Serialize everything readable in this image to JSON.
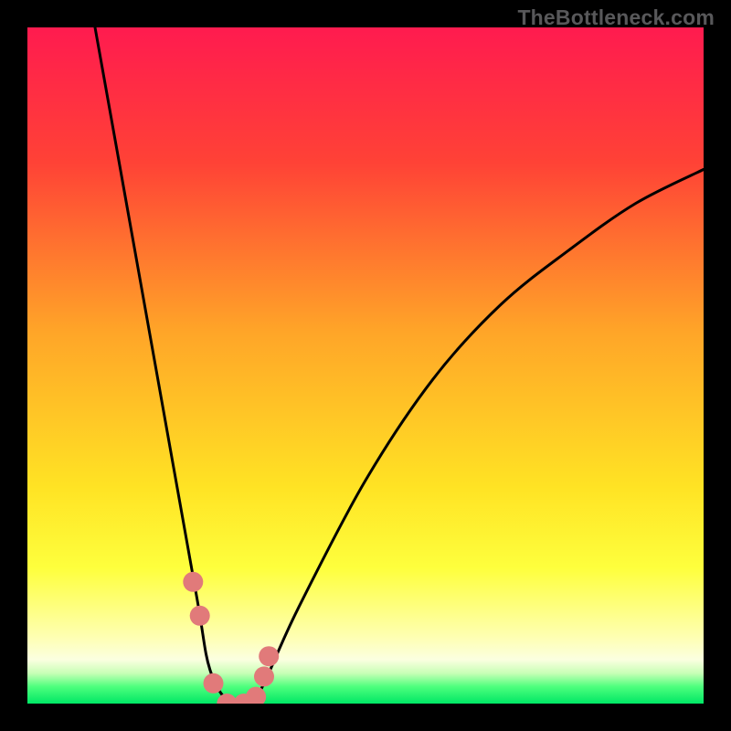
{
  "watermark": "TheBottleneck.com",
  "chart_data": {
    "type": "line",
    "title": "",
    "xlabel": "",
    "ylabel": "",
    "xlim": [
      0,
      100
    ],
    "ylim": [
      0,
      100
    ],
    "series": [
      {
        "name": "bottleneck-curve",
        "x": [
          10,
          15,
          20,
          25,
          27,
          30,
          33,
          35,
          40,
          50,
          60,
          70,
          80,
          90,
          100
        ],
        "values": [
          100,
          72,
          44,
          16,
          5,
          0,
          0,
          3,
          14,
          33,
          48,
          59,
          67,
          74,
          79
        ]
      }
    ],
    "markers": {
      "name": "highlight-points",
      "x": [
        24.5,
        25.5,
        27.5,
        29.5,
        32,
        33.8,
        35,
        35.7
      ],
      "values": [
        18,
        13,
        3,
        0,
        0,
        1,
        4,
        7
      ]
    },
    "background_gradient": {
      "stops": [
        {
          "pos": 0.0,
          "color": "#ff1b4f"
        },
        {
          "pos": 0.2,
          "color": "#ff4236"
        },
        {
          "pos": 0.45,
          "color": "#ffa528"
        },
        {
          "pos": 0.68,
          "color": "#ffe324"
        },
        {
          "pos": 0.8,
          "color": "#feff3d"
        },
        {
          "pos": 0.9,
          "color": "#feffb0"
        },
        {
          "pos": 0.935,
          "color": "#fbffe0"
        },
        {
          "pos": 0.955,
          "color": "#c8ffb6"
        },
        {
          "pos": 0.975,
          "color": "#4eff7d"
        },
        {
          "pos": 1.0,
          "color": "#00e765"
        }
      ]
    }
  }
}
